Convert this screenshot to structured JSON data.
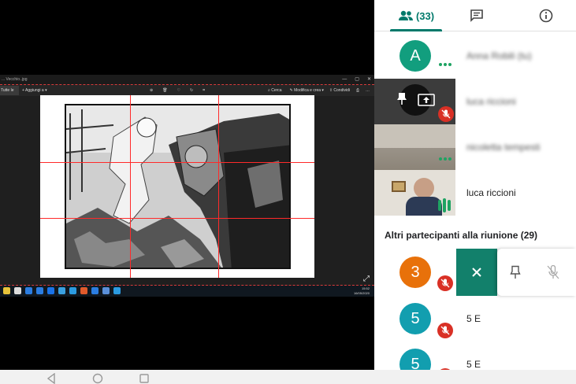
{
  "shared_screen": {
    "window_title": "... Vecchio..jpg",
    "toolbar": {
      "home_label": "Tutte le foto",
      "add_label": "Aggiungi a",
      "search_label": "Cerca",
      "edit_label": "Modifica e crea",
      "share_label": "Condividi"
    },
    "taskbar_time": "15:52",
    "taskbar_date": "16/05/2020"
  },
  "panel": {
    "tabs": {
      "people_count": "(33)"
    },
    "participants": [
      {
        "initial": "A",
        "name": "Anna Robili (tu)",
        "avatar_color": "#129e7e"
      },
      {
        "name": "luca riccioni"
      },
      {
        "name": "nicoletta tempesti"
      },
      {
        "name": "luca riccioni"
      }
    ],
    "section_title": "Altri partecipanti alla riunione (29)",
    "others": [
      {
        "initial": "3",
        "name": "",
        "avatar_color": "#e8710a"
      },
      {
        "initial": "5",
        "name": "5 E",
        "avatar_color": "#129eaf"
      },
      {
        "initial": "5",
        "name": "5 E",
        "avatar_color": "#129eaf"
      }
    ]
  },
  "colors": {
    "accent": "#00796b",
    "mute_red": "#d93025",
    "grid_red": "#ff2a2a"
  }
}
